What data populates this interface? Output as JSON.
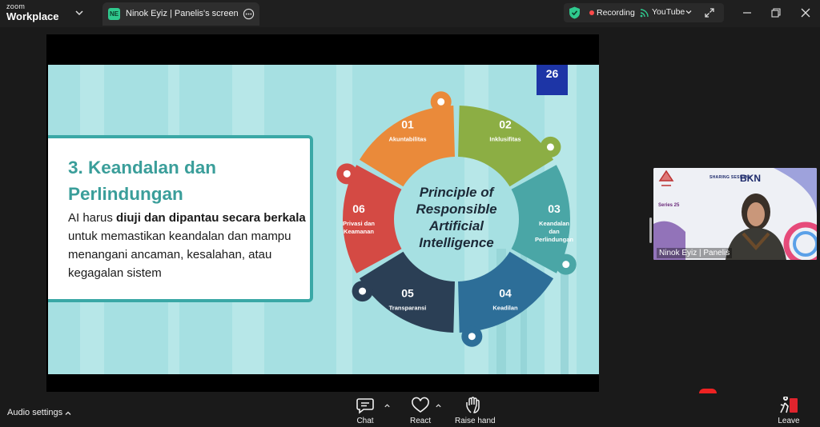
{
  "app": {
    "logo_line1": "zoom",
    "logo_line2": "Workplace"
  },
  "tab": {
    "badge": "NE",
    "title": "Ninok Eyiz | Panelis's screen"
  },
  "status": {
    "recording": "Recording",
    "stream": "YouTube"
  },
  "slide": {
    "page_number": "26",
    "heading": "3. Keandalan dan Perlindungan",
    "body_pre": "AI harus ",
    "body_bold1": "diuji dan dipantau secara berkala",
    "body_post": " untuk memastikan keandalan dan mampu menangani ancaman, kesalahan, atau kegagalan sistem",
    "center_title": [
      "Principle of",
      "Responsible",
      "Artificial",
      "Intelligence"
    ],
    "segments": [
      {
        "num": "01",
        "label": [
          "Akuntabilitas"
        ],
        "color": "#ea8a3a"
      },
      {
        "num": "02",
        "label": [
          "Inklusifitas"
        ],
        "color": "#8cae44"
      },
      {
        "num": "03",
        "label": [
          "Keandalan",
          "dan",
          "Perlindungan"
        ],
        "color": "#4aa6a6"
      },
      {
        "num": "04",
        "label": [
          "Keadilan"
        ],
        "color": "#2d6e98"
      },
      {
        "num": "05",
        "label": [
          "Transparansi"
        ],
        "color": "#2b3f55"
      },
      {
        "num": "06",
        "label": [
          "Privasi dan",
          "Keamanan"
        ],
        "color": "#d44a44"
      }
    ]
  },
  "self_view": {
    "name": "Ninok Eyiz | Panelis",
    "brand_small": "SHARING SESSION",
    "brand_big": "BKN",
    "series": "Series 25"
  },
  "toolbar": {
    "audio": "Audio settings",
    "chat": "Chat",
    "react": "React",
    "raise": "Raise hand",
    "leave": "Leave"
  }
}
